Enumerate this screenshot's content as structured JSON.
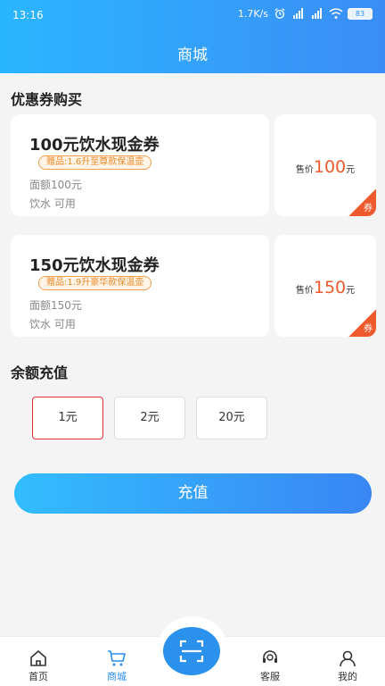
{
  "status_bar": {
    "time": "13:16",
    "speed": "1.7K/s",
    "battery": "83"
  },
  "header": {
    "title": "商城"
  },
  "coupons": {
    "section_title": "优惠券购买",
    "items": [
      {
        "name": "100元饮水现金券",
        "gift": "赠品:1.6升至尊款保温壶",
        "face": "面额100元",
        "scope": "饮水 可用",
        "price_label": "售价",
        "price": "100",
        "price_unit": "元",
        "badge": "券"
      },
      {
        "name": "150元饮水现金券",
        "gift": "赠品:1.9升豪华款保温壶",
        "face": "面额150元",
        "scope": "饮水 可用",
        "price_label": "售价",
        "price": "150",
        "price_unit": "元",
        "badge": "券"
      }
    ]
  },
  "recharge": {
    "section_title": "余额充值",
    "amounts": [
      "1元",
      "2元",
      "20元"
    ],
    "selected_index": 0,
    "button_label": "充值"
  },
  "tabbar": {
    "items": [
      {
        "label": "首页",
        "icon": "home-icon"
      },
      {
        "label": "商城",
        "icon": "cart-icon",
        "active": true
      },
      {
        "label": "",
        "icon": "scan-icon"
      },
      {
        "label": "客服",
        "icon": "headset-icon"
      },
      {
        "label": "我的",
        "icon": "user-icon"
      }
    ]
  },
  "colors": {
    "accent": "#2a8ef2",
    "price": "#ee5a2e",
    "selected_border": "#dd3333"
  }
}
